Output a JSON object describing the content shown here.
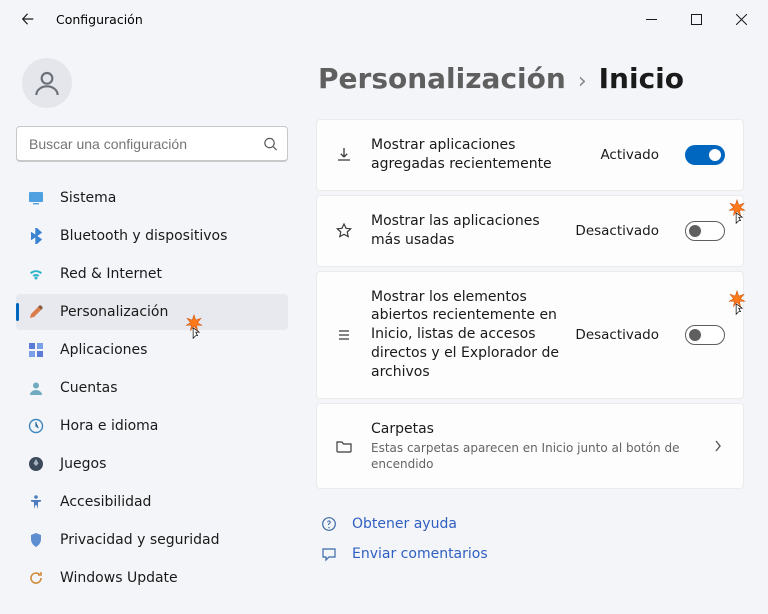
{
  "window": {
    "title": "Configuración"
  },
  "search": {
    "placeholder": "Buscar una configuración"
  },
  "nav": [
    {
      "id": "system",
      "label": "Sistema"
    },
    {
      "id": "bluetooth",
      "label": "Bluetooth y dispositivos"
    },
    {
      "id": "network",
      "label": "Red & Internet"
    },
    {
      "id": "personalization",
      "label": "Personalización",
      "selected": true
    },
    {
      "id": "apps",
      "label": "Aplicaciones"
    },
    {
      "id": "accounts",
      "label": "Cuentas"
    },
    {
      "id": "time",
      "label": "Hora e idioma"
    },
    {
      "id": "gaming",
      "label": "Juegos"
    },
    {
      "id": "accessibility",
      "label": "Accesibilidad"
    },
    {
      "id": "privacy",
      "label": "Privacidad y seguridad"
    },
    {
      "id": "update",
      "label": "Windows Update"
    }
  ],
  "breadcrumb": {
    "parent": "Personalización",
    "current": "Inicio"
  },
  "settings": {
    "recently_added": {
      "title": "Mostrar aplicaciones agregadas recientemente",
      "state_label": "Activado",
      "on": true
    },
    "most_used": {
      "title": "Mostrar las aplicaciones más usadas",
      "state_label": "Desactivado",
      "on": false
    },
    "recent_items": {
      "title": "Mostrar los elementos abiertos recientemente en Inicio, listas de accesos directos y el Explorador de archivos",
      "state_label": "Desactivado",
      "on": false
    },
    "folders": {
      "title": "Carpetas",
      "subtitle": "Estas carpetas aparecen en Inicio junto al botón de encendido"
    }
  },
  "links": {
    "help": "Obtener ayuda",
    "feedback": "Enviar comentarios"
  }
}
